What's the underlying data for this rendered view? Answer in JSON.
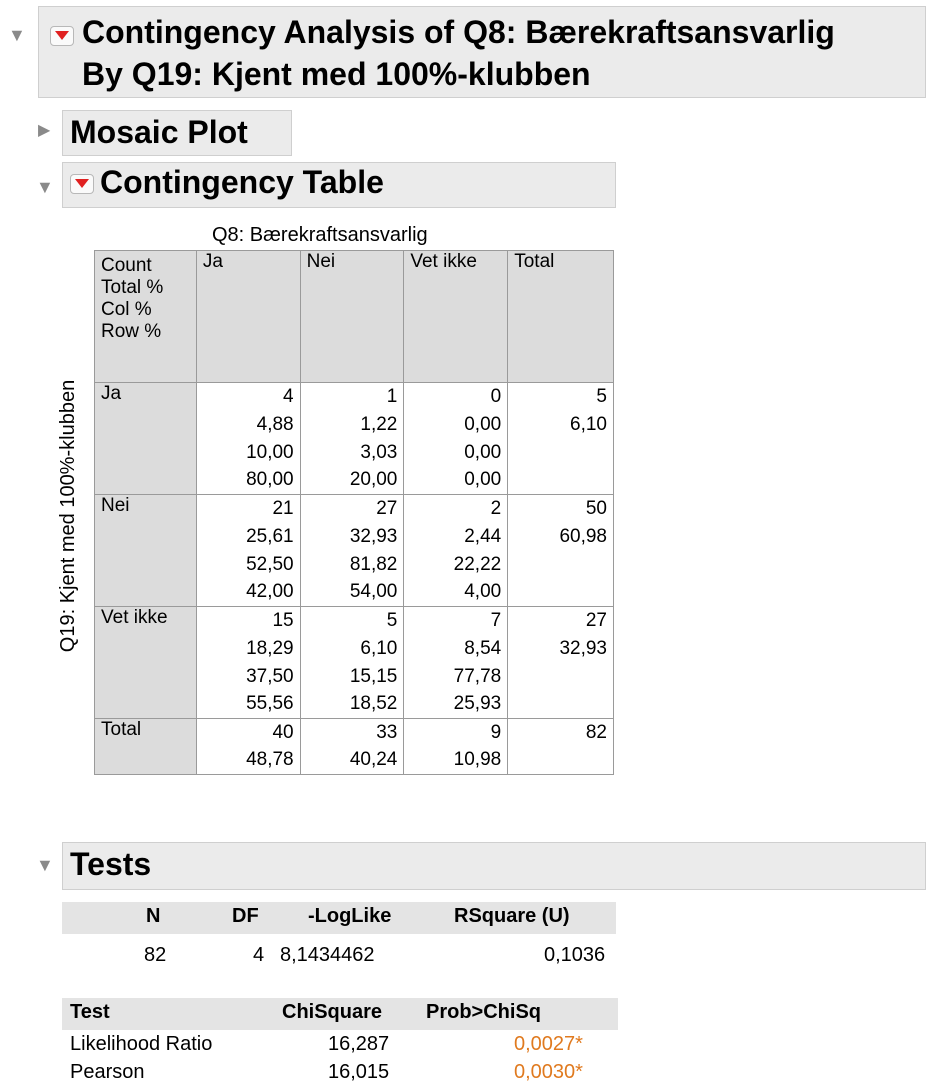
{
  "outline": {
    "title_line1": "Contingency Analysis of Q8: Bærekraftsansvarlig",
    "title_line2": "By Q19: Kjent med 100%-klubben",
    "mosaic_title": "Mosaic Plot",
    "contingency_title": "Contingency Table",
    "tests_title": "Tests"
  },
  "contingency": {
    "col_var": "Q8: Bærekraftsansvarlig",
    "row_var": "Q19: Kjent med 100%-klubben",
    "legend": [
      "Count",
      "Total %",
      "Col %",
      "Row %"
    ],
    "columns": [
      "Ja",
      "Nei",
      "Vet ikke",
      "Total"
    ],
    "rows": [
      {
        "label": "Ja",
        "count": [
          "4",
          "1",
          "0",
          "5"
        ],
        "total_pct": [
          "4,88",
          "1,22",
          "0,00",
          "6,10"
        ],
        "col_pct": [
          "10,00",
          "3,03",
          "0,00"
        ],
        "row_pct": [
          "80,00",
          "20,00",
          "0,00"
        ]
      },
      {
        "label": "Nei",
        "count": [
          "21",
          "27",
          "2",
          "50"
        ],
        "total_pct": [
          "25,61",
          "32,93",
          "2,44",
          "60,98"
        ],
        "col_pct": [
          "52,50",
          "81,82",
          "22,22"
        ],
        "row_pct": [
          "42,00",
          "54,00",
          "4,00"
        ]
      },
      {
        "label": "Vet ikke",
        "count": [
          "15",
          "5",
          "7",
          "27"
        ],
        "total_pct": [
          "18,29",
          "6,10",
          "8,54",
          "32,93"
        ],
        "col_pct": [
          "37,50",
          "15,15",
          "77,78"
        ],
        "row_pct": [
          "55,56",
          "18,52",
          "25,93"
        ]
      }
    ],
    "total_row": {
      "label": "Total",
      "count": [
        "40",
        "33",
        "9",
        "82"
      ],
      "total_pct": [
        "48,78",
        "40,24",
        "10,98"
      ]
    }
  },
  "tests": {
    "summary_headers": [
      "N",
      "DF",
      "-LogLike",
      "RSquare (U)"
    ],
    "summary_values": [
      "82",
      "4",
      "8,1434462",
      "0,1036"
    ],
    "test_headers": [
      "Test",
      "ChiSquare",
      "Prob>ChiSq"
    ],
    "test_rows": [
      {
        "test": "Likelihood Ratio",
        "chisq": "16,287",
        "prob": "0,0027*"
      },
      {
        "test": "Pearson",
        "chisq": "16,015",
        "prob": "0,0030*"
      }
    ]
  },
  "colors": {
    "significant": "#e07a1f",
    "header_bg": "#ebebeb",
    "cell_gray": "#dcdcdc"
  }
}
